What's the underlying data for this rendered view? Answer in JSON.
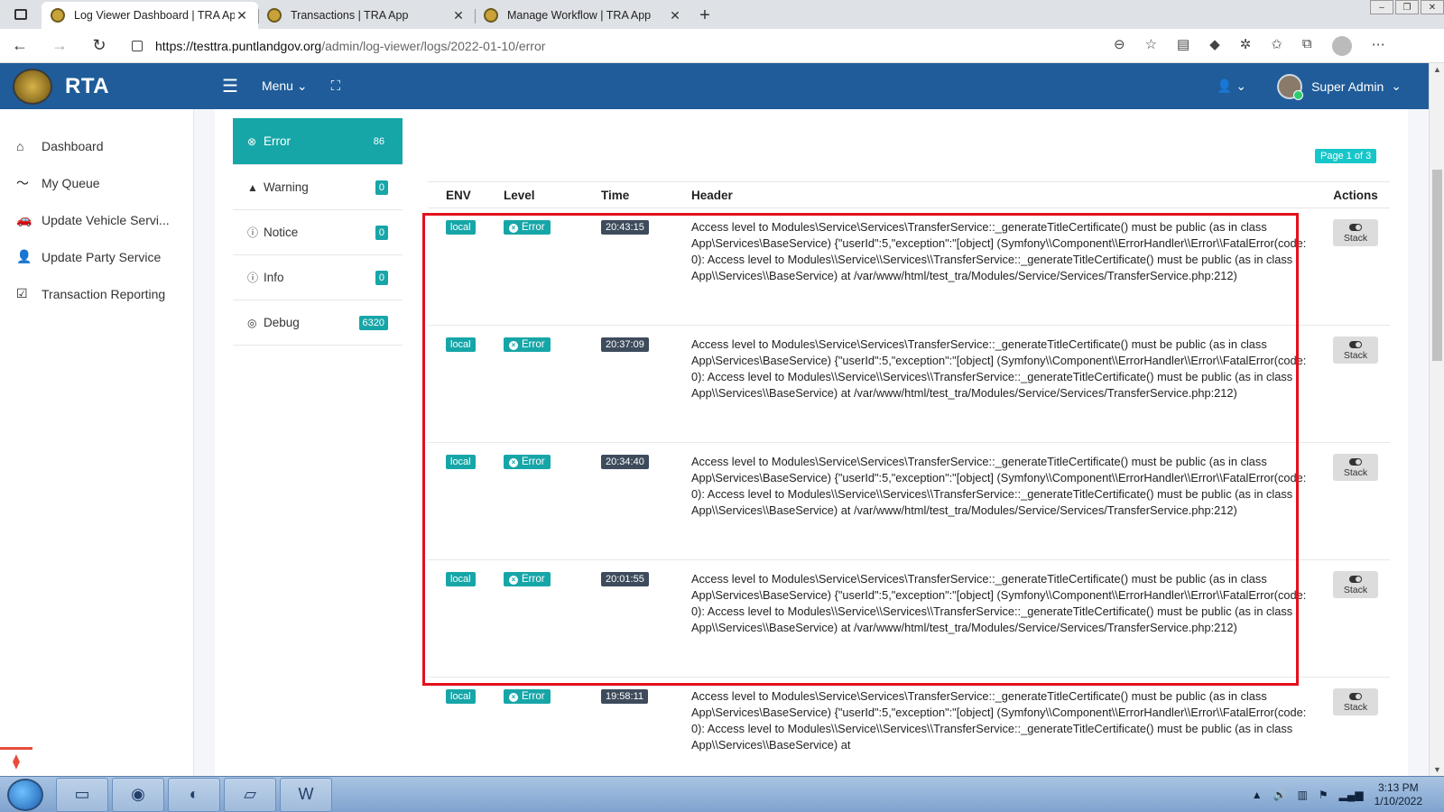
{
  "browser": {
    "tabs": [
      {
        "title": "Log Viewer Dashboard | TRA App",
        "active": true
      },
      {
        "title": "Transactions | TRA App",
        "active": false
      },
      {
        "title": "Manage Workflow | TRA App",
        "active": false
      }
    ],
    "url_host": "https://testtra.puntlandgov.org",
    "url_path": "/admin/log-viewer/logs/2022-01-10/error"
  },
  "header": {
    "brand": "RTA",
    "menu_label": "Menu",
    "user_name": "Super Admin"
  },
  "sidebar": {
    "items": [
      {
        "label": "Dashboard",
        "icon": "home-icon"
      },
      {
        "label": "My Queue",
        "icon": "trend-line-icon"
      },
      {
        "label": "Update Vehicle Servi...",
        "icon": "car-icon"
      },
      {
        "label": "Update Party Service",
        "icon": "user-icon"
      },
      {
        "label": "Transaction Reporting",
        "icon": "checkbox-icon"
      }
    ]
  },
  "levels": [
    {
      "label": "Error",
      "count": "86",
      "icon": "times-circle-icon",
      "active": true
    },
    {
      "label": "Warning",
      "count": "0",
      "icon": "warning-icon",
      "active": false
    },
    {
      "label": "Notice",
      "count": "0",
      "icon": "info-circle-icon",
      "active": false
    },
    {
      "label": "Info",
      "count": "0",
      "icon": "info-circle-icon",
      "active": false
    },
    {
      "label": "Debug",
      "count": "6320",
      "icon": "life-ring-icon",
      "active": false
    }
  ],
  "pagination": {
    "label": "Page 1 of 3"
  },
  "table": {
    "columns": {
      "env": "ENV",
      "level": "Level",
      "time": "Time",
      "header": "Header",
      "actions": "Actions"
    },
    "action_label": "Stack",
    "rows": [
      {
        "env": "local",
        "level": "Error",
        "time": "20:43:15",
        "header": "Access level to Modules\\Service\\Services\\TransferService::_generateTitleCertificate() must be public (as in class App\\Services\\BaseService) {\"userId\":5,\"exception\":\"[object] (Symfony\\\\Component\\\\ErrorHandler\\\\Error\\\\FatalError(code: 0): Access level to Modules\\\\Service\\\\Services\\\\TransferService::_generateTitleCertificate() must be public (as in class App\\\\Services\\\\BaseService) at /var/www/html/test_tra/Modules/Service/Services/TransferService.php:212)"
      },
      {
        "env": "local",
        "level": "Error",
        "time": "20:37:09",
        "header": "Access level to Modules\\Service\\Services\\TransferService::_generateTitleCertificate() must be public (as in class App\\Services\\BaseService) {\"userId\":5,\"exception\":\"[object] (Symfony\\\\Component\\\\ErrorHandler\\\\Error\\\\FatalError(code: 0): Access level to Modules\\\\Service\\\\Services\\\\TransferService::_generateTitleCertificate() must be public (as in class App\\\\Services\\\\BaseService) at /var/www/html/test_tra/Modules/Service/Services/TransferService.php:212)"
      },
      {
        "env": "local",
        "level": "Error",
        "time": "20:34:40",
        "header": "Access level to Modules\\Service\\Services\\TransferService::_generateTitleCertificate() must be public (as in class App\\Services\\BaseService) {\"userId\":5,\"exception\":\"[object] (Symfony\\\\Component\\\\ErrorHandler\\\\Error\\\\FatalError(code: 0): Access level to Modules\\\\Service\\\\Services\\\\TransferService::_generateTitleCertificate() must be public (as in class App\\\\Services\\\\BaseService) at /var/www/html/test_tra/Modules/Service/Services/TransferService.php:212)"
      },
      {
        "env": "local",
        "level": "Error",
        "time": "20:01:55",
        "header": "Access level to Modules\\Service\\Services\\TransferService::_generateTitleCertificate() must be public (as in class App\\Services\\BaseService) {\"userId\":5,\"exception\":\"[object] (Symfony\\\\Component\\\\ErrorHandler\\\\Error\\\\FatalError(code: 0): Access level to Modules\\\\Service\\\\Services\\\\TransferService::_generateTitleCertificate() must be public (as in class App\\\\Services\\\\BaseService) at /var/www/html/test_tra/Modules/Service/Services/TransferService.php:212)"
      },
      {
        "env": "local",
        "level": "Error",
        "time": "19:58:11",
        "header": "Access level to Modules\\Service\\Services\\TransferService::_generateTitleCertificate() must be public (as in class App\\Services\\BaseService) {\"userId\":5,\"exception\":\"[object] (Symfony\\\\Component\\\\ErrorHandler\\\\Error\\\\FatalError(code: 0): Access level to Modules\\\\Service\\\\Services\\\\TransferService::_generateTitleCertificate() must be public (as in class App\\\\Services\\\\BaseService) at"
      }
    ]
  },
  "taskbar": {
    "time": "3:13 PM",
    "date": "1/10/2022"
  },
  "colors": {
    "header_bg": "#1f5c99",
    "teal_accent": "#17a6a8",
    "time_badge": "#3d4b5c",
    "highlight_border": "#e3101c"
  }
}
